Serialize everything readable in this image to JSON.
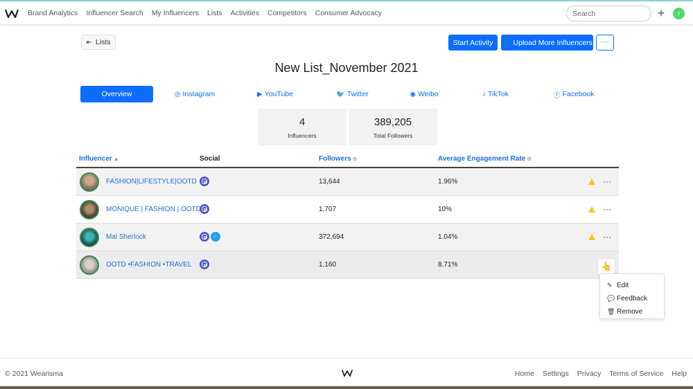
{
  "nav": {
    "links": [
      "Brand Analytics",
      "Influencer Search",
      "My Influencers",
      "Lists",
      "Activities",
      "Competitors",
      "Consumer Advocacy"
    ],
    "search_placeholder": "Search",
    "plus": "+",
    "user_initial": "i",
    "user_color": "#4cd964"
  },
  "header": {
    "back_label": "Lists",
    "start_activity": "Start Activity",
    "upload_label": "Upload More Influencers",
    "more": "···"
  },
  "title": "New List_November 2021",
  "tabs": [
    "Overview",
    "Instagram",
    "YouTube",
    "Twitter",
    "Weibo",
    "TikTok",
    "Facebook"
  ],
  "stats": [
    {
      "value": "4",
      "label": "Influencers"
    },
    {
      "value": "389,205",
      "label": "Total Followers"
    }
  ],
  "table": {
    "headers": {
      "influencer": "Influencer",
      "social": "Social",
      "followers": "Followers",
      "engagement": "Average Engagement Rate"
    },
    "rows": [
      {
        "name": "FASHION|LIFESTYLE|OOTD",
        "followers": "13,644",
        "engagement": "1.96%",
        "socials": [
          "instagram"
        ],
        "warning": true
      },
      {
        "name": "MONIQUE | FASHION | OOTD",
        "followers": "1,707",
        "engagement": "10%",
        "socials": [
          "instagram"
        ],
        "warning": true
      },
      {
        "name": "Mal Sherlock",
        "followers": "372,694",
        "engagement": "1.04%",
        "socials": [
          "instagram",
          "twitter"
        ],
        "warning": true
      },
      {
        "name": "OOTD •FASHION •TRAVEL",
        "followers": "1,160",
        "engagement": "8.71%",
        "socials": [
          "instagram"
        ],
        "warning": false
      }
    ]
  },
  "row_menu": [
    "Edit",
    "Feedback",
    "Remove"
  ],
  "footer": {
    "copyright": "© 2021 Wearisma",
    "links": [
      "Home",
      "Settings",
      "Privacy",
      "Terms of Service",
      "Help"
    ]
  },
  "colors": {
    "primary": "#0d6efd",
    "link": "#1f6fd1",
    "warning": "#f5c518",
    "instagram": "#4a57c8",
    "twitter": "#1da1f2"
  }
}
